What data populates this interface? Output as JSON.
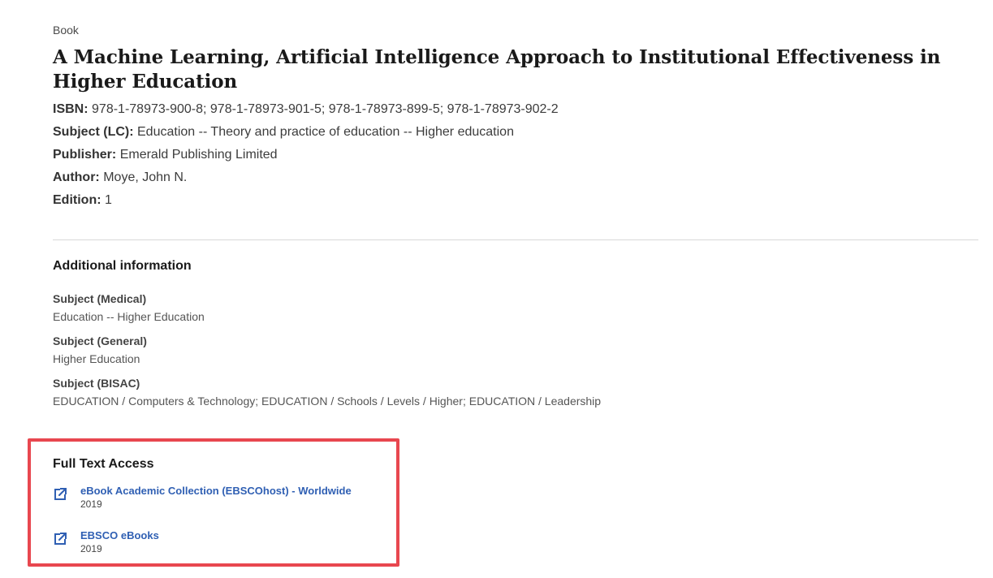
{
  "record": {
    "type": "Book",
    "title": "A Machine Learning, Artificial Intelligence Approach to Institutional Effectiveness in Higher Education",
    "fields": [
      {
        "label": "ISBN:",
        "value": "978-1-78973-900-8; 978-1-78973-901-5; 978-1-78973-899-5; 978-1-78973-902-2"
      },
      {
        "label": "Subject (LC):",
        "value": "Education -- Theory and practice of education -- Higher education"
      },
      {
        "label": "Publisher:",
        "value": "Emerald Publishing Limited"
      },
      {
        "label": "Author:",
        "value": "Moye, John N."
      },
      {
        "label": "Edition:",
        "value": "1"
      }
    ]
  },
  "additional": {
    "heading": "Additional information",
    "items": [
      {
        "label": "Subject (Medical)",
        "value": "Education -- Higher Education"
      },
      {
        "label": "Subject (General)",
        "value": "Higher Education"
      },
      {
        "label": "Subject (BISAC)",
        "value": "EDUCATION / Computers & Technology; EDUCATION / Schools / Levels / Higher; EDUCATION / Leadership"
      }
    ]
  },
  "full_text_access": {
    "heading": "Full Text Access",
    "highlight_color": "#e8474f",
    "link_color": "#2f5fb3",
    "entries": [
      {
        "icon": "external-link-icon",
        "label": "eBook Academic Collection (EBSCOhost) - Worldwide",
        "year": "2019"
      },
      {
        "icon": "external-link-icon",
        "label": "EBSCO eBooks",
        "year": "2019"
      }
    ]
  }
}
